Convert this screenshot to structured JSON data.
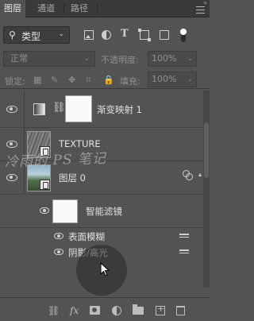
{
  "tabs": [
    {
      "label": "图层",
      "active": true
    },
    {
      "label": "通道",
      "active": false
    },
    {
      "label": "路径",
      "active": false
    }
  ],
  "filter": {
    "kind_label": "类型",
    "icons": [
      "image-filter-icon",
      "adjustment-filter-icon",
      "type-filter-icon",
      "shape-filter-icon",
      "smart-object-filter-icon"
    ]
  },
  "blend": {
    "mode": "正常",
    "opacity_label": "不透明度:",
    "opacity_value": "100%"
  },
  "lock": {
    "label": "锁定:",
    "fill_label": "填充:",
    "fill_value": "100%"
  },
  "layers": [
    {
      "name": "渐变映射 1",
      "type": "adjustment"
    },
    {
      "name": "TEXTURE",
      "type": "smart-object"
    },
    {
      "name": "图层 0",
      "type": "smart-object"
    }
  ],
  "smart_filters": {
    "label": "智能滤镜",
    "items": [
      "表面模糊",
      "阴影/高光"
    ]
  },
  "watermark": "冷雨的 PS 笔记",
  "colors": {
    "panel_bg": "#535353",
    "tabbar_bg": "#3a3a3a",
    "text": "#e2e2e2"
  }
}
